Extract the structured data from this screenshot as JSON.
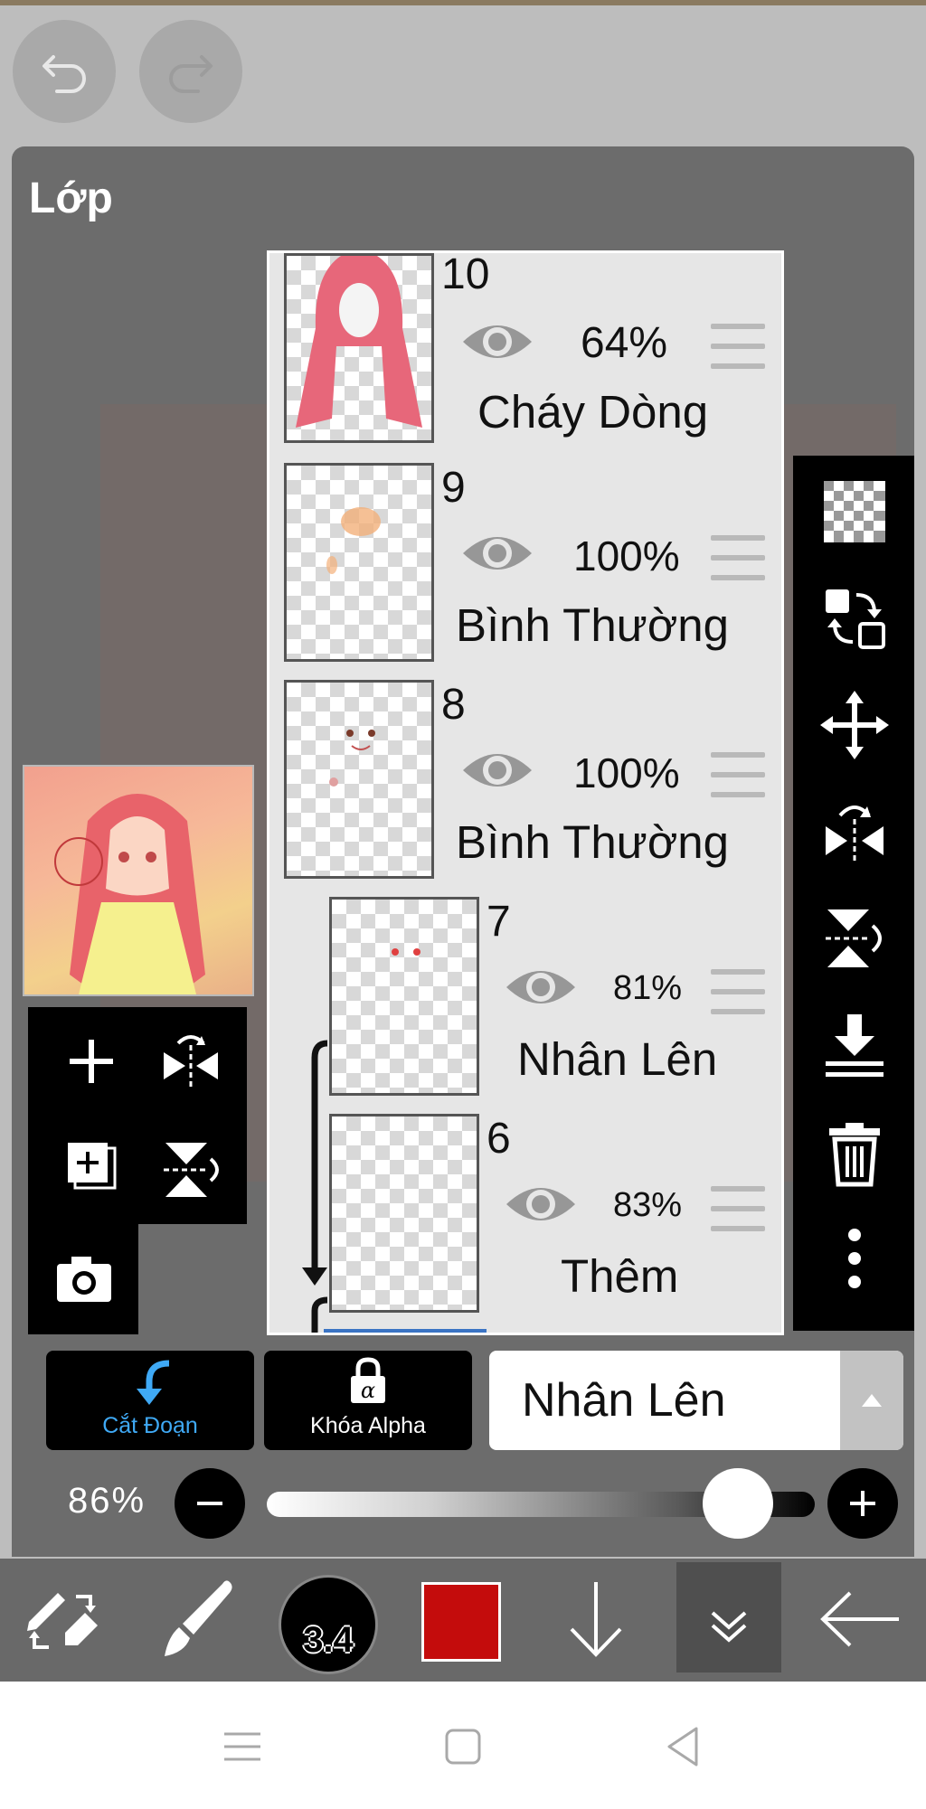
{
  "panel": {
    "title": "Lớp"
  },
  "layers": [
    {
      "number": "10",
      "opacity": "64%",
      "blend": "Cháy Dòng",
      "clipped": false
    },
    {
      "number": "9",
      "opacity": "100%",
      "blend": "Bình Thường",
      "clipped": false
    },
    {
      "number": "8",
      "opacity": "100%",
      "blend": "Bình Thường",
      "clipped": false
    },
    {
      "number": "7",
      "opacity": "81%",
      "blend": "Nhân Lên",
      "clipped": true
    },
    {
      "number": "6",
      "opacity": "83%",
      "blend": "Thêm",
      "clipped": true
    }
  ],
  "controls": {
    "clip_label": "Cắt Đoạn",
    "alpha_lock_label": "Khóa Alpha",
    "blend_mode": "Nhân Lên",
    "layer_opacity_label": "86%",
    "layer_opacity_value": 0.86
  },
  "toolbar": {
    "brush_size": "3.4",
    "current_color": "#c40c0c"
  },
  "colors": {
    "accent_blue": "#3fa9f5",
    "panel_bg": "#6c6c6c",
    "list_bg": "#e6e6e6"
  }
}
